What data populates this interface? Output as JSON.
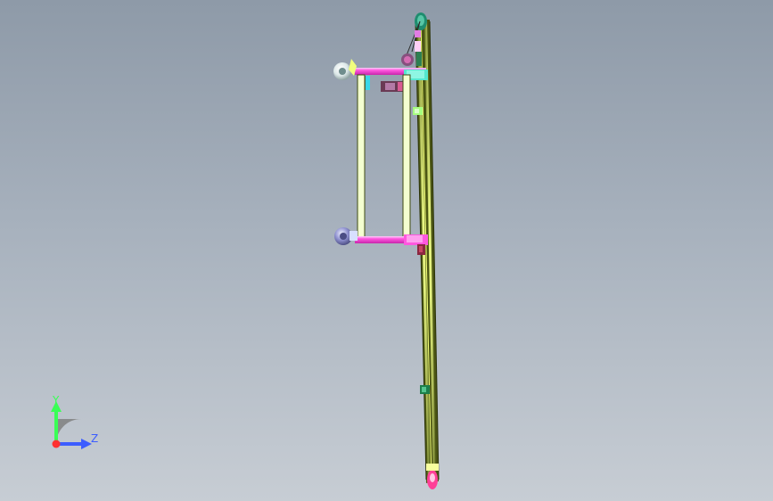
{
  "viewport": {
    "background_top": "#8e9aa8",
    "background_bottom": "#c7cdd4"
  },
  "axis_triad": {
    "y_label": "Y",
    "z_label": "Z",
    "y_color": "#39ff55",
    "z_color": "#3c5dff",
    "origin_color": "#ff3030",
    "arc_color": "#808080"
  },
  "model": {
    "name": "cad-assembly-side-view",
    "frame_color": "#f4ffd0",
    "support_color": "#ff40dc",
    "conveyor_color": "#4f5a12",
    "accent_green": "#1d8c6a",
    "accent_pink": "#ff3f97",
    "accent_dark": "#6d3a52",
    "wheel_color": "#7a7bb9",
    "wheel_light_color": "#e5ecec"
  }
}
